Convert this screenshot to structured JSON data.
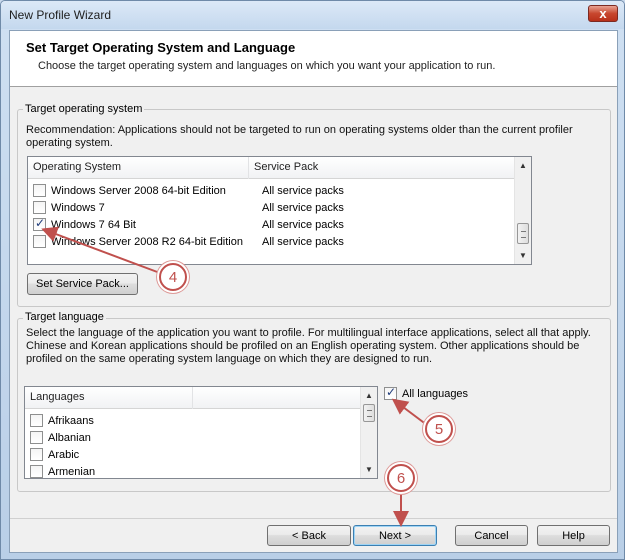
{
  "window": {
    "title": "New Profile Wizard",
    "close_glyph": "x"
  },
  "header": {
    "title": "Set Target Operating System and Language",
    "subtitle": "Choose the target operating system and languages on which you want your application to run."
  },
  "target_os": {
    "group_label": "Target operating system",
    "recommendation_line1": "Recommendation: Applications should not be targeted to run on operating systems older than the current profiler",
    "recommendation_line2": "operating system.",
    "columns": [
      "Operating System",
      "Service Pack"
    ],
    "rows": [
      {
        "name": "Windows Server 2008 64-bit Edition",
        "service_pack": "All service packs",
        "checked": false
      },
      {
        "name": "Windows 7",
        "service_pack": "All service packs",
        "checked": false
      },
      {
        "name": "Windows 7 64 Bit",
        "service_pack": "All service packs",
        "checked": true
      },
      {
        "name": "Windows Server 2008 R2 64-bit Edition",
        "service_pack": "All service packs",
        "checked": false
      }
    ],
    "set_service_pack_label": "Set Service Pack..."
  },
  "target_language": {
    "group_label": "Target language",
    "description_line1": "Select the language of the application you want to profile. For multilingual interface applications, select all that apply.",
    "description_line2": "Chinese and Korean applications should be profiled on an English operating system. Other applications should be",
    "description_line3": "profiled on the same operating system language on which they are designed to run.",
    "column": "Languages",
    "languages": [
      {
        "name": "Afrikaans",
        "checked": false
      },
      {
        "name": "Albanian",
        "checked": false
      },
      {
        "name": "Arabic",
        "checked": false
      },
      {
        "name": "Armenian",
        "checked": false
      }
    ],
    "all_languages_label": "All languages",
    "all_languages_checked": true
  },
  "callouts": [
    "4",
    "5",
    "6"
  ],
  "buttons": {
    "back": "< Back",
    "next": "Next >",
    "cancel": "Cancel",
    "help": "Help"
  },
  "colors": {
    "callout_red": "#c0504d",
    "default_button_border": "#3c7fb1"
  }
}
